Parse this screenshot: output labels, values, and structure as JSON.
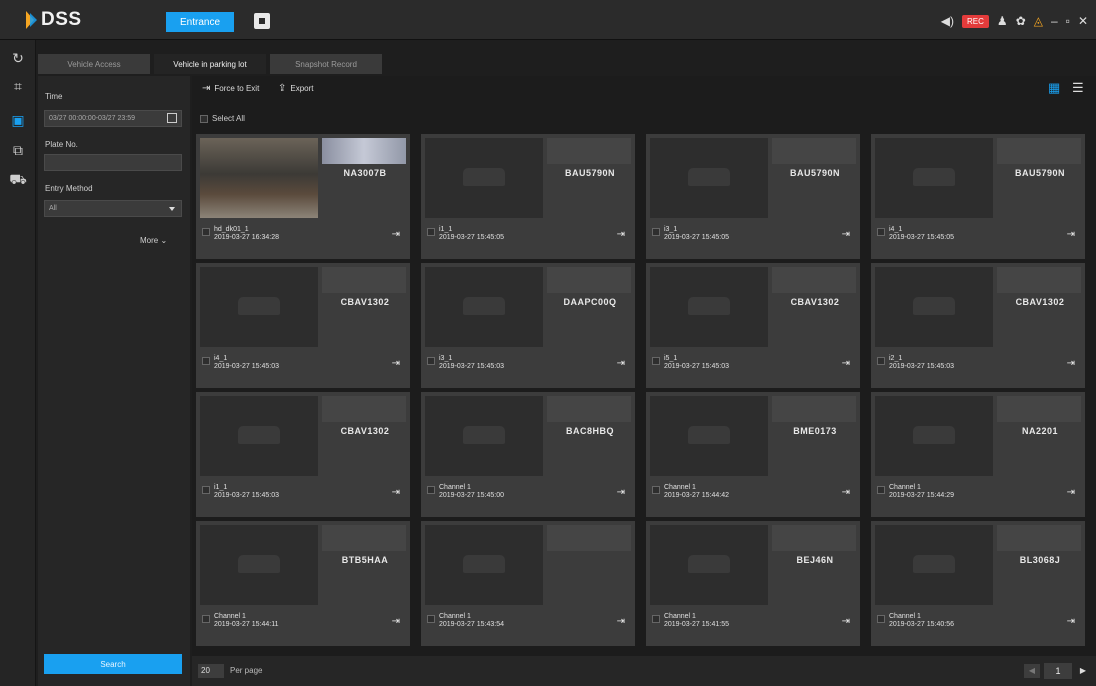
{
  "app": {
    "title": "DSS"
  },
  "header": {
    "tab_entrance": "Entrance",
    "recording_badge": "REC"
  },
  "tabs": [
    {
      "label": "Vehicle Access"
    },
    {
      "label": "Vehicle in parking lot"
    },
    {
      "label": "Snapshot Record"
    }
  ],
  "filter": {
    "time_label": "Time",
    "time_value": "03/27 00:00:00-03/27 23:59",
    "plate_label": "Plate No.",
    "plate_value": "",
    "entry_label": "Entry Method",
    "entry_value": "All",
    "more_label": "More ⌄",
    "search_label": "Search"
  },
  "toolbar": {
    "force_exit": "Force to Exit",
    "export": "Export",
    "select_all": "Select All"
  },
  "cards": [
    {
      "channel": "hd_dk01_1",
      "time": "2019-03-27 16:34:28",
      "plate": "NA3007B",
      "photo": true
    },
    {
      "channel": "i1_1",
      "time": "2019-03-27 15:45:05",
      "plate": "BAU5790N",
      "photo": false
    },
    {
      "channel": "i3_1",
      "time": "2019-03-27 15:45:05",
      "plate": "BAU5790N",
      "photo": false
    },
    {
      "channel": "i4_1",
      "time": "2019-03-27 15:45:05",
      "plate": "BAU5790N",
      "photo": false
    },
    {
      "channel": "i4_1",
      "time": "2019-03-27 15:45:03",
      "plate": "CBAV1302",
      "photo": false
    },
    {
      "channel": "i3_1",
      "time": "2019-03-27 15:45:03",
      "plate": "DAAPC00Q",
      "photo": false
    },
    {
      "channel": "i5_1",
      "time": "2019-03-27 15:45:03",
      "plate": "CBAV1302",
      "photo": false
    },
    {
      "channel": "i2_1",
      "time": "2019-03-27 15:45:03",
      "plate": "CBAV1302",
      "photo": false
    },
    {
      "channel": "i1_1",
      "time": "2019-03-27 15:45:03",
      "plate": "CBAV1302",
      "photo": false
    },
    {
      "channel": "Channel 1",
      "time": "2019-03-27 15:45:00",
      "plate": "BAC8HBQ",
      "photo": false
    },
    {
      "channel": "Channel 1",
      "time": "2019-03-27 15:44:42",
      "plate": "BME0173",
      "photo": false
    },
    {
      "channel": "Channel 1",
      "time": "2019-03-27 15:44:29",
      "plate": "NA2201",
      "photo": false
    },
    {
      "channel": "Channel 1",
      "time": "2019-03-27 15:44:11",
      "plate": "BTB5HAA",
      "photo": false
    },
    {
      "channel": "Channel 1",
      "time": "2019-03-27 15:43:54",
      "plate": "",
      "photo": false
    },
    {
      "channel": "Channel 1",
      "time": "2019-03-27 15:41:55",
      "plate": "BEJ46N",
      "photo": false
    },
    {
      "channel": "Channel 1",
      "time": "2019-03-27 15:40:56",
      "plate": "BL3068J",
      "photo": false
    }
  ],
  "pager": {
    "page_size": "20",
    "per_page_label": "Per page",
    "current_page": "1"
  },
  "colors": {
    "accent": "#19a0f0",
    "background": "#1e1e1e",
    "card": "#3c3c3c"
  }
}
